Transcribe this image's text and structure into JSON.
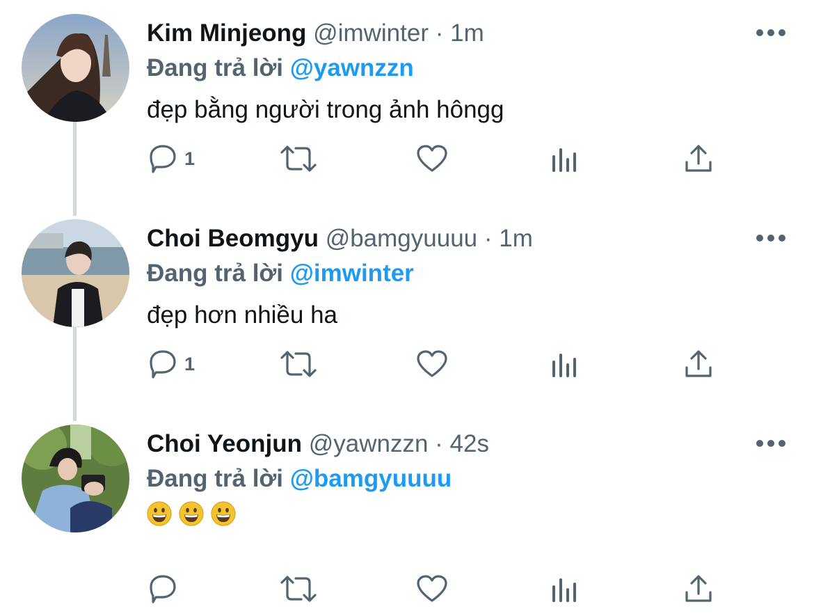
{
  "tweets": [
    {
      "name": "Kim Minjeong",
      "handle": "@imwinter",
      "dot": "·",
      "time": "1m",
      "replying_prefix": "Đang trả lời",
      "replying_to": "@yawnzzn",
      "text": "đẹp bằng người trong ảnh hôngg",
      "reply_count": "1"
    },
    {
      "name": "Choi Beomgyu",
      "handle": "@bamgyuuuu",
      "dot": "·",
      "time": "1m",
      "replying_prefix": "Đang trả lời",
      "replying_to": "@imwinter",
      "text": "đẹp hơn nhiều ha",
      "reply_count": "1"
    },
    {
      "name": "Choi Yeonjun",
      "handle": "@yawnzzn",
      "dot": "·",
      "time": "42s",
      "replying_prefix": "Đang trả lời",
      "replying_to": "@bamgyuuuu",
      "emojis": [
        "grinning-face",
        "grinning-face",
        "grinning-face"
      ],
      "reply_count": ""
    }
  ],
  "icons": {
    "reply": "reply-icon",
    "retweet": "retweet-icon",
    "like": "heart-icon",
    "views": "views-icon",
    "share": "share-icon",
    "more": "more-icon"
  },
  "colors": {
    "name": "#0f1419",
    "secondary": "#536471",
    "mention": "#1d9bf0",
    "thread_line": "#cfd9de",
    "emoji": "#f4c430"
  }
}
